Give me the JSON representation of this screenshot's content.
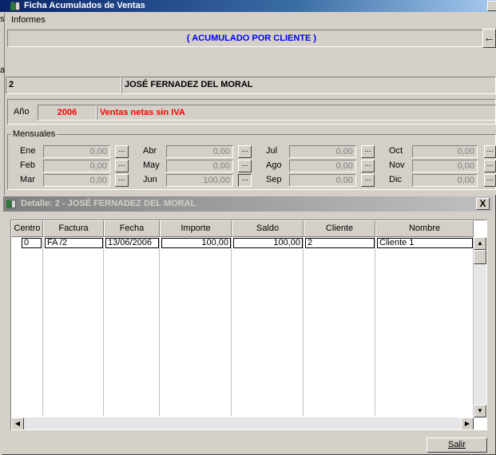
{
  "window": {
    "title": "Ficha Acumulados de Ventas"
  },
  "menu": {
    "informes": "Informes"
  },
  "edge": {
    "glyph1": "s",
    "glyph2": "a"
  },
  "header": {
    "banner": "( ACUMULADO POR CLIENTE )",
    "back_icon": "←"
  },
  "client": {
    "code": "2",
    "name": "JOSÉ FERNADEZ DEL MORAL"
  },
  "year": {
    "label": "Año",
    "value": "2006",
    "sales_type": "Ventas netas sin IVA"
  },
  "monthly": {
    "legend": "Mensuales",
    "btn_label": "...",
    "months": [
      {
        "label": "Ene",
        "value": "0,00"
      },
      {
        "label": "Feb",
        "value": "0,00"
      },
      {
        "label": "Mar",
        "value": "0,00"
      },
      {
        "label": "Abr",
        "value": "0,00"
      },
      {
        "label": "May",
        "value": "0,00"
      },
      {
        "label": "Jun",
        "value": "100,00"
      },
      {
        "label": "Jul",
        "value": "0,00"
      },
      {
        "label": "Ago",
        "value": "0,00"
      },
      {
        "label": "Sep",
        "value": "0,00"
      },
      {
        "label": "Oct",
        "value": "0,00"
      },
      {
        "label": "Nov",
        "value": "0,00"
      },
      {
        "label": "Dic",
        "value": "0,00"
      }
    ]
  },
  "detail": {
    "title": "Detalle: 2 - JOSÉ FERNADEZ DEL MORAL",
    "close_label": "X",
    "columns": [
      "Centro",
      "Factura",
      "Fecha",
      "Importe",
      "Saldo",
      "Cliente",
      "Nombre"
    ],
    "rows": [
      [
        "0",
        "FA /2",
        "13/06/2006",
        "100,00",
        "100,00",
        "2",
        "Cliente 1"
      ]
    ],
    "salir_label": "Salir"
  }
}
